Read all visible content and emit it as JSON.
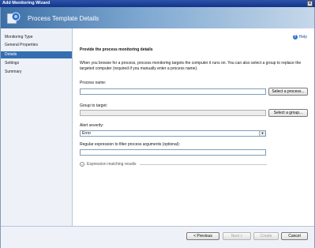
{
  "window": {
    "title": "Add Monitoring Wizard",
    "close_glyph": "✕"
  },
  "header": {
    "title": "Process Template Details",
    "icon": "wizard-icon"
  },
  "sidebar": {
    "items": [
      {
        "label": "Monitoring Type",
        "active": false
      },
      {
        "label": "General Properties",
        "active": false
      },
      {
        "label": "Details",
        "active": true
      },
      {
        "label": "Settings",
        "active": false
      },
      {
        "label": "Summary",
        "active": false
      }
    ]
  },
  "main": {
    "help_label": "Help",
    "heading": "Provide the process monitoring details",
    "description": "When you browse for a process, process monitoring targets the computer it runs on. You can also select a group to replace the targeted computer (required if you manually enter a process name).",
    "process_name": {
      "label": "Process name:",
      "value": ""
    },
    "select_process_button": "Select a process...",
    "group_target": {
      "label": "Group to target:",
      "value": ""
    },
    "select_group_button": "Select a group...",
    "alert_severity": {
      "label": "Alert severity:",
      "value": "Error"
    },
    "regex": {
      "label": "Regular expression to filter process arguments (optional):",
      "value": ""
    },
    "expander_label": "Expression matching results"
  },
  "footer": {
    "previous": "< Previous",
    "next": "Next >",
    "create": "Create",
    "cancel": "Cancel"
  },
  "colors": {
    "accent": "#3470b0",
    "title_bar": "#1e43a0"
  }
}
